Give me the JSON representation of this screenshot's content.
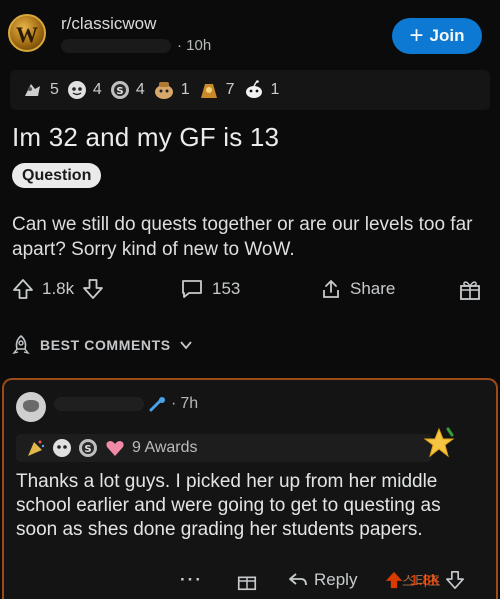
{
  "post": {
    "subreddit": "r/classicwow",
    "subreddit_icon_letter": "W",
    "age": "10h",
    "join_label": "Join",
    "title": "Im 32 and my GF is 13",
    "flair": "Question",
    "body": "Can we still do quests together or are our levels too far apart? Sorry kind of new to WoW.",
    "awards": [
      {
        "icon": "wholesome-award-icon",
        "count": "5",
        "color": "#c9c9c9"
      },
      {
        "icon": "helpful-award-icon",
        "count": "4",
        "color": "#d9d9d9"
      },
      {
        "icon": "silver-award-icon",
        "count": "4",
        "color": "#bdbdbd"
      },
      {
        "icon": "bravo-award-icon",
        "count": "1",
        "color": "#d8a86b"
      },
      {
        "icon": "gold-award-icon",
        "count": "7",
        "color": "#e6b34a"
      },
      {
        "icon": "snoo-award-icon",
        "count": "1",
        "color": "#ffffff"
      }
    ],
    "upvotes": "1.8k",
    "comments": "153",
    "share_label": "Share"
  },
  "comments_header": {
    "label": "BEST COMMENTS"
  },
  "comment": {
    "age": "7h",
    "awards_label": "9 Awards",
    "body": "Thanks a lot guys. I picked her up from her middle school earlier and were going to get to questing as soon as shes done grading her students papers.",
    "more_label": "···",
    "reply_label": "Reply",
    "score": "1.8k",
    "watermark": "스티즈"
  },
  "colors": {
    "accent": "#0e79d2",
    "highlight_border": "#9c4a17",
    "upvote": "#d93a00"
  }
}
